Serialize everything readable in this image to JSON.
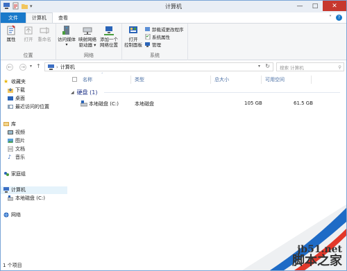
{
  "window": {
    "title": "计算机",
    "buttons": {
      "minimize": "—",
      "maximize": "□",
      "close": "✕"
    }
  },
  "tabs": {
    "file": "文件",
    "computer": "计算机",
    "view": "查看"
  },
  "ribbon": {
    "location_group": {
      "label": "位置",
      "properties": "属性",
      "open": "打开",
      "rename": "重命名"
    },
    "network_group": {
      "label": "网络",
      "access_media": "访问媒体",
      "map_drive": "映射网络\n驱动器",
      "map_drive_l1": "映射网络",
      "map_drive_l2": "驱动器 ▾",
      "add_location_l1": "添加一个",
      "add_location_l2": "网络位置"
    },
    "system_group": {
      "label": "系统",
      "open_cp_l1": "打开",
      "open_cp_l2": "控制面板",
      "uninstall": "卸载或更改程序",
      "sys_props": "系统属性",
      "manage": "管理"
    }
  },
  "address": {
    "path": "计算机",
    "search_placeholder": "搜索 计算机"
  },
  "nav": {
    "favorites": "收藏夹",
    "downloads": "下载",
    "desktop": "桌面",
    "recent": "最近访问的位置",
    "libraries": "库",
    "videos": "视频",
    "pictures": "图片",
    "documents": "文档",
    "music": "音乐",
    "homegroup": "家庭组",
    "computer": "计算机",
    "local_disk": "本地磁盘 (C:)",
    "network": "网络"
  },
  "columns": {
    "name": "名称",
    "type": "类型",
    "total": "总大小",
    "free": "可用空间"
  },
  "group": {
    "label": "硬盘 (1)"
  },
  "rows": [
    {
      "name": "本地磁盘 (C:)",
      "type": "本地磁盘",
      "total": "105 GB",
      "free": "61.5 GB"
    }
  ],
  "status": {
    "count": "1 个项目"
  },
  "watermark": {
    "site": "jb51.net",
    "brand": "脚本之家"
  }
}
